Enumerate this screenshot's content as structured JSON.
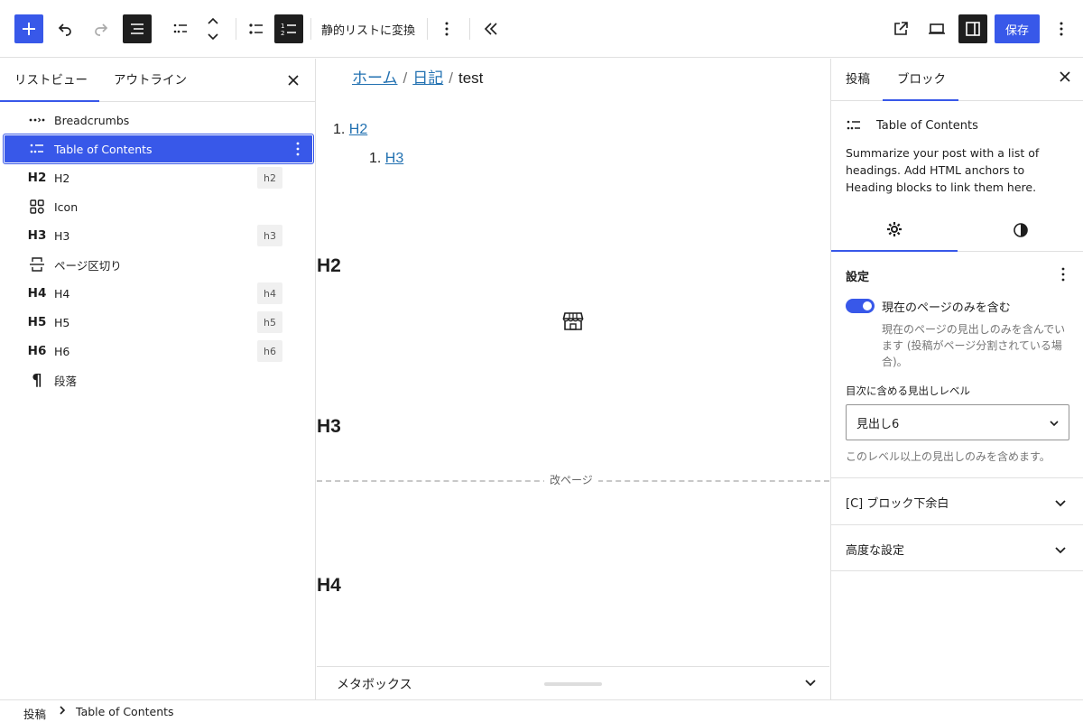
{
  "toolbar": {
    "convert_label": "静的リストに変換",
    "save_label": "保存"
  },
  "left_panel": {
    "tabs": [
      "リストビュー",
      "アウトライン"
    ],
    "items": [
      {
        "label": "Breadcrumbs",
        "icon": "breadcrumbs-icon",
        "badge": ""
      },
      {
        "label": "Table of Contents",
        "icon": "table-of-contents-icon",
        "badge": ""
      },
      {
        "label": "H2",
        "icon_text": "H2",
        "badge": "h2"
      },
      {
        "label": "Icon",
        "icon": "icon-block-icon",
        "badge": ""
      },
      {
        "label": "H3",
        "icon_text": "H3",
        "badge": "h3"
      },
      {
        "label": "ページ区切り",
        "icon": "page-break-icon",
        "badge": ""
      },
      {
        "label": "H4",
        "icon_text": "H4",
        "badge": "h4"
      },
      {
        "label": "H5",
        "icon_text": "H5",
        "badge": "h5"
      },
      {
        "label": "H6",
        "icon_text": "H6",
        "badge": "h6"
      },
      {
        "label": "段落",
        "icon_text": "¶",
        "badge": ""
      }
    ]
  },
  "canvas": {
    "breadcrumbs": [
      "ホーム",
      "日記",
      "test"
    ],
    "toc": [
      {
        "number": "1.",
        "label": "H2"
      },
      {
        "number": "1.",
        "label": "H3"
      }
    ],
    "headings": [
      "H2",
      "H3",
      "H4"
    ],
    "page_break_label": "改ページ"
  },
  "metabox": {
    "label": "メタボックス"
  },
  "right_panel": {
    "tabs": [
      "投稿",
      "ブロック"
    ],
    "block_name": "Table of Contents",
    "block_description": "Summarize your post with a list of headings. Add HTML anchors to Heading blocks to link them here.",
    "settings_title": "設定",
    "toggle_label": "現在のページのみを含む",
    "toggle_on": true,
    "toggle_help": "現在のページの見出しのみを含んでいます (投稿がページ分割されている場合)。",
    "select_label": "目次に含める見出しレベル",
    "select_value": "見出し6",
    "select_help": "このレベル以上の見出しのみを含めます。",
    "panels": [
      "[C] ブロック下余白",
      "高度な設定"
    ]
  },
  "statusbar": {
    "items": [
      "投稿",
      "Table of Contents"
    ]
  },
  "colors": {
    "accent": "#3858e9",
    "link": "#2271b1"
  }
}
